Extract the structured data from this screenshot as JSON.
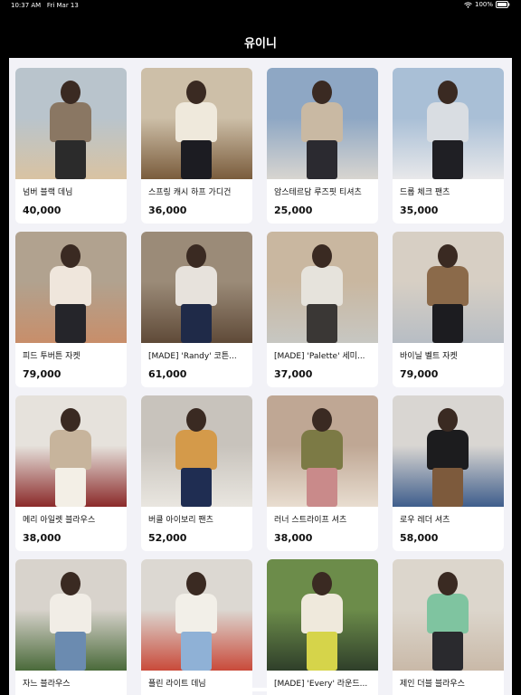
{
  "status_bar": {
    "time": "10:37 AM",
    "date": "Fri Mar 13",
    "battery_pct": "100%"
  },
  "nav": {
    "title": "유이니"
  },
  "products": [
    {
      "name": "넘버 블랙 데님",
      "price": "40,000",
      "palette": [
        "#b9c4cc",
        "#8a7763",
        "#2b2b2b",
        "#d9c3a2"
      ]
    },
    {
      "name": "스프링 캐시 하프 가디건",
      "price": "36,000",
      "palette": [
        "#cdbfa8",
        "#efe9dc",
        "#1c1c22",
        "#7a5c3c"
      ]
    },
    {
      "name": "암스테르담 루즈핏 티셔츠",
      "price": "25,000",
      "palette": [
        "#8ea7c4",
        "#c9b9a3",
        "#2b2a30",
        "#d8d5d0"
      ]
    },
    {
      "name": "드롭 체크 팬츠",
      "price": "35,000",
      "palette": [
        "#a9bfd6",
        "#d9dde2",
        "#1f1f24",
        "#e8e8ea"
      ]
    },
    {
      "name": "피드 투버튼 자켓",
      "price": "79,000",
      "palette": [
        "#b1a28f",
        "#efe6dc",
        "#25252a",
        "#c88e6a"
      ]
    },
    {
      "name": "[MADE] 'Randy' 코튼...",
      "price": "61,000",
      "palette": [
        "#9b8b78",
        "#e7e2dc",
        "#1f2a48",
        "#5f4a38"
      ]
    },
    {
      "name": "[MADE] 'Palette' 세미...",
      "price": "37,000",
      "palette": [
        "#c9b7a0",
        "#e6e3dc",
        "#3a3735",
        "#c7c7c2"
      ]
    },
    {
      "name": "바이닐 벨트 자켓",
      "price": "79,000",
      "palette": [
        "#d7cfc4",
        "#8b6a4a",
        "#1c1c20",
        "#b7bdc4"
      ]
    },
    {
      "name": "메리 아일렛 블라우스",
      "price": "38,000",
      "palette": [
        "#e6e2dc",
        "#c7b49c",
        "#f3efe6",
        "#8b2a2a"
      ]
    },
    {
      "name": "버클 아이보리 팬츠",
      "price": "52,000",
      "palette": [
        "#c8c3bc",
        "#d49a4a",
        "#1f2d52",
        "#e9e6e0"
      ]
    },
    {
      "name": "러너 스트라이프 셔츠",
      "price": "38,000",
      "palette": [
        "#bfa794",
        "#7c7a45",
        "#c98a8a",
        "#e8ddd0"
      ]
    },
    {
      "name": "로우 레더 셔츠",
      "price": "58,000",
      "palette": [
        "#d9d6d2",
        "#1c1c1e",
        "#7d5a3c",
        "#3f5e8c"
      ]
    },
    {
      "name": "자느 블라우스",
      "price": "",
      "palette": [
        "#d8d3cc",
        "#f1ede6",
        "#6b8bb0",
        "#4a6a3a"
      ]
    },
    {
      "name": "플린 라이트 데님",
      "price": "",
      "palette": [
        "#dcd8d2",
        "#f2efe8",
        "#8fb1d6",
        "#c94a3a"
      ]
    },
    {
      "name": "[MADE] 'Every' 라운드...",
      "price": "",
      "palette": [
        "#6c8c4a",
        "#efe9dc",
        "#d6d44a",
        "#2f3f2a"
      ]
    },
    {
      "name": "제인 더블 블라우스",
      "price": "",
      "palette": [
        "#dcd6cc",
        "#7fc4a0",
        "#2a2a2e",
        "#c9b9a8"
      ]
    }
  ]
}
